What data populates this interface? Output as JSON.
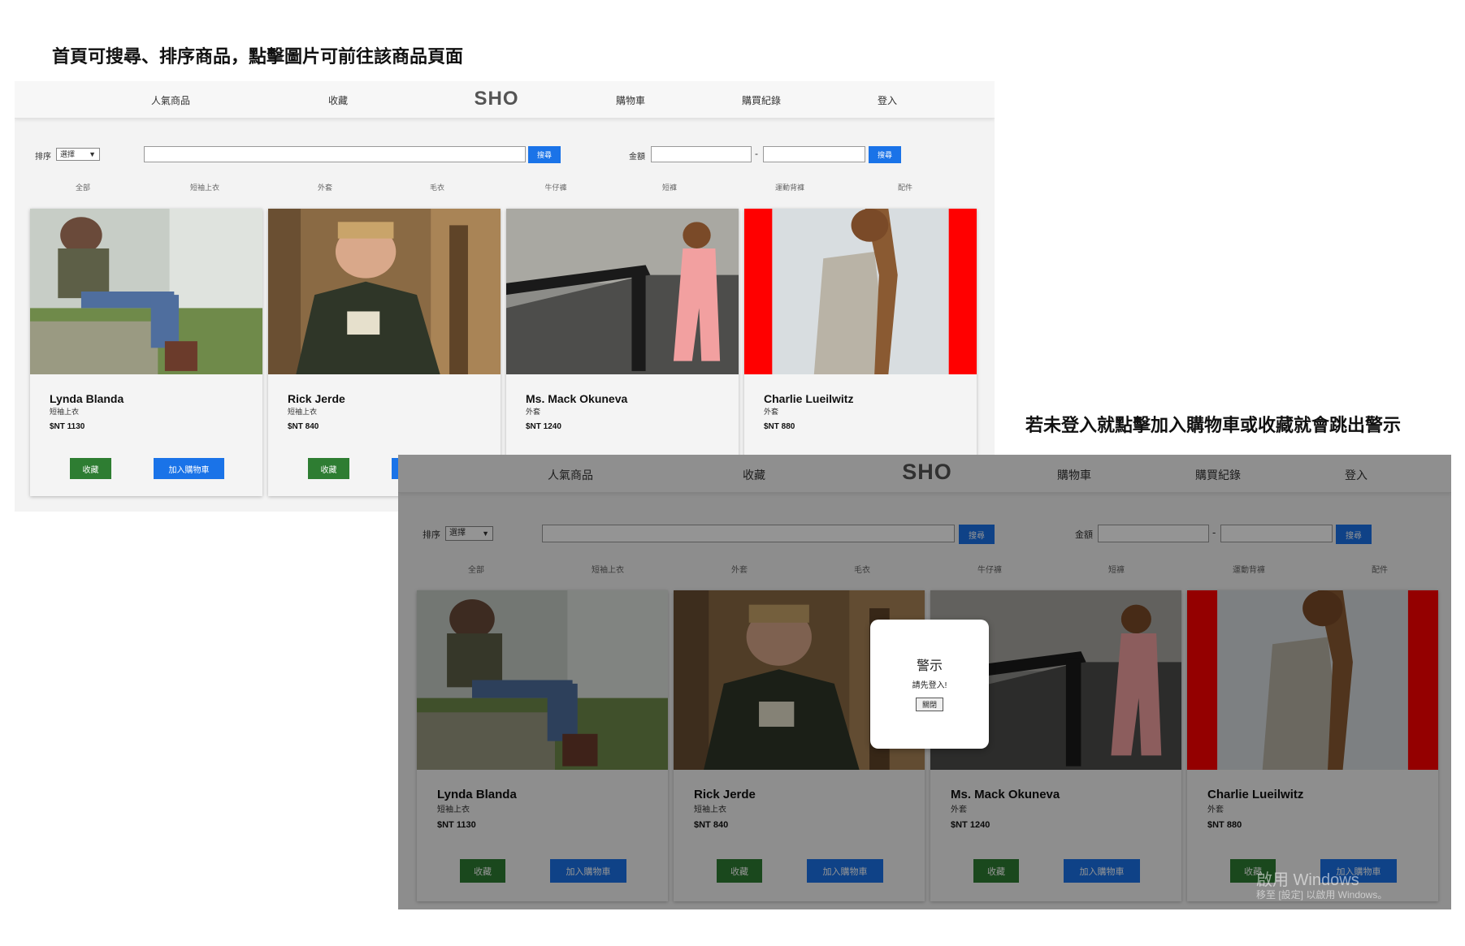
{
  "captions": {
    "top_left": "首頁可搜尋、排序商品，點擊圖片可前往該商品頁面",
    "right": "若未登入就點擊加入購物車或收藏就會跳出警示"
  },
  "nav": {
    "popular": "人氣商品",
    "favorites": "收藏",
    "brand": "SHO",
    "cart": "購物車",
    "history": "購買紀錄",
    "login": "登入"
  },
  "toolbar": {
    "sort_label": "排序",
    "sort_value": "選擇",
    "search_button": "搜尋",
    "amount_label": "金額",
    "range_dash": "-",
    "filter_button": "搜尋"
  },
  "categories": [
    "全部",
    "短袖上衣",
    "外套",
    "毛衣",
    "牛仔褲",
    "短褲",
    "運動背褲",
    "配件"
  ],
  "products": [
    {
      "name": "Lynda Blanda",
      "category": "短袖上衣",
      "price": "$NT 1130"
    },
    {
      "name": "Rick Jerde",
      "category": "短袖上衣",
      "price": "$NT 840"
    },
    {
      "name": "Ms. Mack Okuneva",
      "category": "外套",
      "price": "$NT 1240"
    },
    {
      "name": "Charlie Lueilwitz",
      "category": "外套",
      "price": "$NT 880"
    }
  ],
  "card_buttons": {
    "favorite": "收藏",
    "add_to_cart": "加入購物車"
  },
  "alert": {
    "title": "警示",
    "message": "請先登入!",
    "close": "關閉"
  },
  "watermark": {
    "line1": "啟用 Windows",
    "line2": "移至 [設定] 以啟用 Windows。"
  },
  "colors": {
    "primary": "#1a73e8",
    "favorite": "#2e7d32",
    "accent_red": "#ff0000"
  }
}
